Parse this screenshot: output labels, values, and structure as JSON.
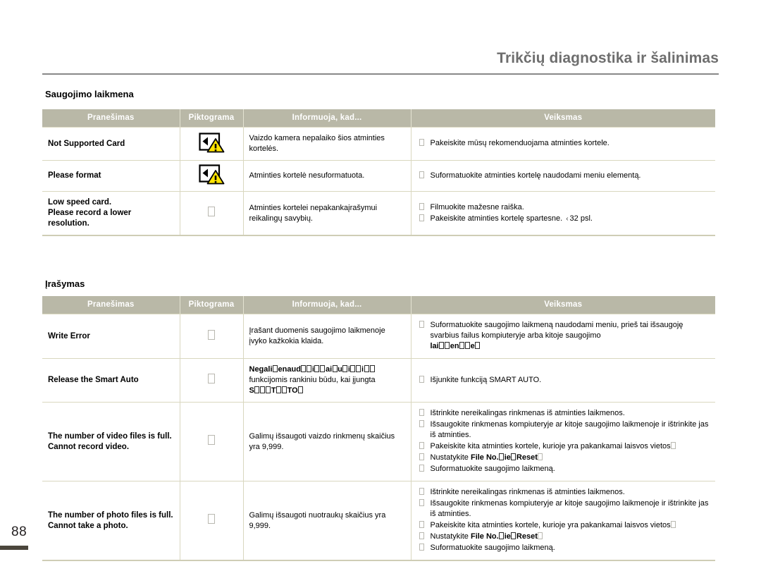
{
  "header": {
    "title": "Trikčių diagnostika ir šalinimas"
  },
  "page_number": "88",
  "columns": {
    "message": "Pranešimas",
    "icon": "Piktograma",
    "info": "Informuoja, kad...",
    "action": "Veiksmas"
  },
  "sections": [
    {
      "title": "Saugojimo laikmena",
      "rows": [
        {
          "message": "Not Supported Card",
          "icon": "memory-card-warning-icon",
          "info": "Vaizdo kamera nepalaiko šios atminties kortelės.",
          "actions": [
            {
              "text": "Pakeiskite mūsų rekomenduojama atminties kortele."
            }
          ]
        },
        {
          "message": "Please format",
          "icon": "memory-card-warning-icon",
          "info": "Atminties kortelė nesuformatuota.",
          "actions": [
            {
              "text": "Suformatuokite atminties kortelę naudodami meniu elementą."
            }
          ]
        },
        {
          "message": "Low speed card.\nPlease record a lower resolution.",
          "icon": "missing-glyph",
          "info": "Atminties kortelei nepakankaįrašymui reikalingų savybių.",
          "actions": [
            {
              "text": "Filmuokite mažesne raiška."
            },
            {
              "text": "Pakeiskite atminties kortelę spartesne.",
              "page_ref": "32 psl.",
              "arrow": "‹"
            }
          ]
        }
      ]
    },
    {
      "title": "Įrašymas",
      "rows": [
        {
          "message": "Write Error",
          "icon": "missing-glyph",
          "info": "Įrašant duomenis saugojimo laikmenoje įvyko kažkokia klaida.",
          "actions": [
            {
              "text": "Suformatuokite saugojimo laikmeną naudodami meniu, prieš tai išsaugoję svarbius failus kompiuteryje arba kitoje saugojimo",
              "bold_tail": "lai□□en□□e□"
            }
          ]
        },
        {
          "message": "Release the Smart Auto",
          "icon": "missing-glyph",
          "info_rich": {
            "line1_bold": "Negali□enaud□□i□□ai□u□i□□i□□",
            "line2": "funkcijomis rankiniu būdu, kai įjungta",
            "line3_bold": "S□□□T□□TO□"
          },
          "actions": [
            {
              "text": "Išjunkite funkciją SMART AUTO."
            }
          ]
        },
        {
          "message": "The number of video files is full.\nCannot record video.",
          "icon": "missing-glyph",
          "info": "Galimų išsaugoti vaizdo rinkmenų skaičius yra 9,999.",
          "actions": [
            {
              "text": "Ištrinkite nereikalingas rinkmenas iš atminties laikmenos."
            },
            {
              "text": "Išsaugokite rinkmenas kompiuteryje ar kitoje saugojimo laikmenoje ir ištrinkite jas iš atminties."
            },
            {
              "text": "Pakeiskite kita atminties kortele, kurioje yra pakankamai laisvos vietos",
              "trailing_glyph": true
            },
            {
              "text": "Nustatykite ",
              "bold_mid": "File No.□ie□Reset",
              "trailing_glyph": true
            },
            {
              "text": "Suformatuokite saugojimo laikmeną."
            }
          ]
        },
        {
          "message": "The number of photo files is full.\nCannot take a photo.",
          "icon": "missing-glyph",
          "info": "Galimų išsaugoti nuotraukų skaičius yra 9,999.",
          "actions": [
            {
              "text": "Ištrinkite nereikalingas rinkmenas iš atminties laikmenos."
            },
            {
              "text": "Išsaugokite rinkmenas kompiuteryje ar kitoje saugojimo laikmenoje ir ištrinkite jas iš atminties."
            },
            {
              "text": "Pakeiskite kita atminties kortele, kurioje yra pakankamai laisvos vietos",
              "trailing_glyph": true
            },
            {
              "text": "Nustatykite ",
              "bold_mid": "File No.□ie□Reset",
              "trailing_glyph": true
            },
            {
              "text": "Suformatuokite saugojimo laikmeną."
            }
          ]
        }
      ]
    }
  ],
  "colors": {
    "table_header_bg": "#b9b8a7",
    "table_border": "#d9d7bf",
    "header_text": "#6e6e6e",
    "warning_yellow": "#ffe400",
    "page_bar": "#4b463c"
  }
}
